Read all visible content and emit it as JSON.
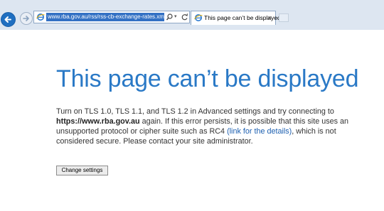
{
  "browser": {
    "url": "www.rba.gov.au/rss/rss-cb-exchange-rates.xml",
    "tab": {
      "title": "This page can’t be displayed",
      "close": "×"
    },
    "icons": {
      "back": "back-arrow-icon",
      "forward": "forward-arrow-icon",
      "page": "ie-page-icon",
      "search": "search-icon",
      "dropdown": "chevron-down-icon",
      "refresh": "refresh-icon"
    },
    "accent_color": "#2a79c6"
  },
  "error_page": {
    "heading": "This page can’t be displayed",
    "message": {
      "part1": "Turn on TLS 1.0, TLS 1.1, and TLS 1.2 in Advanced settings and try connecting to",
      "site": "https://www.rba.gov.au",
      "part2": "again. If this error persists, it is possible that this site uses an unsupported protocol or cipher suite such as RC4",
      "link": "(link for the details)",
      "part3": ", which is not considered secure. Please contact your site administrator."
    },
    "button_label": "Change settings"
  }
}
